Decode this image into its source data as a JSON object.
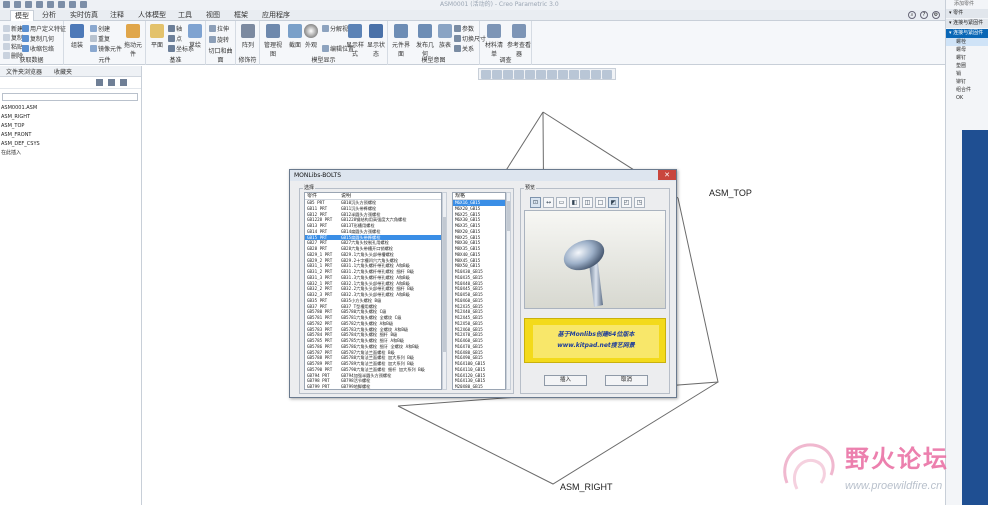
{
  "app": {
    "window_title": "ASM0001 (活动的) - Creo Parametric 3.0"
  },
  "tabs": [
    {
      "label": "模型",
      "active": true
    },
    {
      "label": "分析"
    },
    {
      "label": "实时仿真"
    },
    {
      "label": "注释"
    },
    {
      "label": "人体模型"
    },
    {
      "label": "工具"
    },
    {
      "label": "视图"
    },
    {
      "label": "框架"
    },
    {
      "label": "应用程序"
    }
  ],
  "ribbon": {
    "groups": {
      "data": "获取数据",
      "components": "元件",
      "datum": "基准",
      "cut": "切口和曲面",
      "modifiers": "修饰符",
      "model_display": "模型显示",
      "intent": "模型意图",
      "investigate": "调查"
    },
    "buttons": {
      "new": "新建",
      "copy": "复制",
      "paste": "粘贴",
      "delete": "删除",
      "user_feature": "用户定义特征",
      "copy_geometry": "复制几何",
      "shrinkwrap": "收缩包络",
      "assemble": "组装",
      "create": "创建",
      "repeat": "重复",
      "mirror": "镜像元件",
      "drag": "拖动元件",
      "plane": "平面",
      "axis": "轴",
      "point": "点",
      "csys": "坐标系",
      "sketch": "草绘",
      "extrude": "拉伸",
      "revolve": "旋转",
      "pattern": "阵列",
      "manage_views": "管理视图",
      "section": "截面",
      "appearance": "外观",
      "show_style": "显示样式",
      "display_states": "显示状态",
      "exploded": "分解视图",
      "edit_position": "编辑位置",
      "component_interface": "元件界面",
      "publish_geometry": "发布几何",
      "family_table": "族表",
      "parameters": "参数",
      "switch_dims": "切换尺寸",
      "relations": "关系",
      "bom": "材料清单",
      "ref_viewer": "参考查看器"
    }
  },
  "navigator": {
    "tabs": [
      "文件夹浏览器",
      "收藏夹"
    ],
    "tree": [
      "ASM0001.ASM",
      "ASM_RIGHT",
      "ASM_TOP",
      "ASM_FRONT",
      "ASM_DEF_CSYS",
      "在此插入"
    ]
  },
  "right_panel": {
    "header": "添加零件",
    "sections": [
      {
        "label": "零件",
        "items": []
      },
      {
        "label": "连接与紧固件",
        "items": []
      },
      {
        "label": "连接与紧固件",
        "items": [
          "螺栓",
          "螺母",
          "螺钉",
          "垫圈",
          "销",
          "铆钉",
          "组合件",
          "OK"
        ]
      }
    ]
  },
  "canvas": {
    "labels": {
      "top": "ASM_TOP",
      "right": "ASM_RIGHT"
    }
  },
  "dialog": {
    "title": "MONLibs-BOLTS",
    "close": "✕",
    "select_label": "选择",
    "preview_label": "预览",
    "std_headers": {
      "col1": "零件",
      "col2": "说明"
    },
    "spec_header": "规格",
    "standards": [
      {
        "file": "GB5 PRT",
        "desc": "GB10沉头方颈螺栓"
      },
      {
        "file": "GB11 PRT",
        "desc": "GB11沉头带榫螺栓"
      },
      {
        "file": "GB12 PRT",
        "desc": "GB12半圆头方颈螺栓"
      },
      {
        "file": "GB1228 PRT",
        "desc": "GB1228钢结构用高强度大六角螺栓"
      },
      {
        "file": "GB13 PRT",
        "desc": "GB13T形槽用螺栓"
      },
      {
        "file": "GB14 PRT",
        "desc": "GB14扁圆头方颈螺栓"
      },
      {
        "file": "GB15 PRT",
        "desc": "GB15扁圆头带榫螺栓",
        "selected": true
      },
      {
        "file": "GB27 PRT",
        "desc": "GB27六角头铰制孔用螺栓"
      },
      {
        "file": "GB28 PRT",
        "desc": "GB28六角头带槽开口销螺栓"
      },
      {
        "file": "GB29_1 PRT",
        "desc": "GB29.1六角头头部带槽螺栓"
      },
      {
        "file": "GB29_2 PRT",
        "desc": "GB29.2十字槽凹穴六角头螺栓"
      },
      {
        "file": "GB31_1 PRT",
        "desc": "GB31.1六角头螺杆带孔螺栓 A和B级"
      },
      {
        "file": "GB31_2 PRT",
        "desc": "GB31.2六角头螺杆带孔螺栓 细杆 B级"
      },
      {
        "file": "GB31_3 PRT",
        "desc": "GB31.3六角头螺杆带孔螺栓 A和B级"
      },
      {
        "file": "GB32_1 PRT",
        "desc": "GB32.1六角头头部带孔螺栓 A和B级"
      },
      {
        "file": "GB32_2 PRT",
        "desc": "GB32.2六角头头部带孔螺栓 细杆 B级"
      },
      {
        "file": "GB32_3 PRT",
        "desc": "GB32.3六角头头部带孔螺栓 A和B级"
      },
      {
        "file": "GB35 PRT",
        "desc": "GB35小方头螺栓 B级"
      },
      {
        "file": "GB37 PRT",
        "desc": "GB37 T型槽用螺栓"
      },
      {
        "file": "GB5780 PRT",
        "desc": "GB5780六角头螺栓 C级"
      },
      {
        "file": "GB5781 PRT",
        "desc": "GB5781六角头螺栓 全螺纹 C级"
      },
      {
        "file": "GB5782 PRT",
        "desc": "GB5782六角头螺栓 A和B级"
      },
      {
        "file": "GB5783 PRT",
        "desc": "GB5783六角头螺栓 全螺纹 A和B级"
      },
      {
        "file": "GB5784 PRT",
        "desc": "GB5784六角头螺栓 细杆 B级"
      },
      {
        "file": "GB5785 PRT",
        "desc": "GB5785六角头螺栓 细牙 A和B级"
      },
      {
        "file": "GB5786 PRT",
        "desc": "GB5786六角头螺栓 细牙 全螺纹 A和B级"
      },
      {
        "file": "GB5787 PRT",
        "desc": "GB5787六角法兰面螺栓 B级"
      },
      {
        "file": "GB5788 PRT",
        "desc": "GB5788六角法兰面螺栓 加大系列 B级"
      },
      {
        "file": "GB5789 PRT",
        "desc": "GB5789六角法兰面螺栓 加大系列 B级"
      },
      {
        "file": "GB5790 PRT",
        "desc": "GB5790六角法兰面螺栓 细杆 加大系列 B级"
      },
      {
        "file": "GB794 PRT",
        "desc": "GB794加强半圆头方颈螺栓"
      },
      {
        "file": "GB798 PRT",
        "desc": "GB798活节螺栓"
      },
      {
        "file": "GB799 PRT",
        "desc": "GB799地脚螺栓"
      },
      {
        "file": "GB8 PRT",
        "desc": "GB8方头螺栓"
      },
      {
        "file": "GB800 PRT",
        "desc": "GB800沉头双榫螺栓"
      }
    ],
    "specs": [
      {
        "label": "M6X16_GB15",
        "selected": true
      },
      "M6X20_GB15",
      "M6X25_GB15",
      "M6X30_GB15",
      "M6X35_GB15",
      "M8X20_GB15",
      "M8X25_GB15",
      "M8X30_GB15",
      "M8X35_GB15",
      "M8X40_GB15",
      "M8X45_GB15",
      "M8X50_GB15",
      "M10X30_GB15",
      "M10X35_GB15",
      "M10X40_GB15",
      "M10X45_GB15",
      "M10X50_GB15",
      "M10X60_GB15",
      "M12X35_GB15",
      "M12X40_GB15",
      "M12X45_GB15",
      "M12X50_GB15",
      "M12X60_GB15",
      "M12X70_GB15",
      "M16X60_GB15",
      "M16X70_GB15",
      "M16X80_GB15",
      "M16X90_GB15",
      "M16X100_GB15",
      "M16X110_GB15",
      "M16X120_GB15",
      "M16X130_GB15",
      "M20X80_GB15",
      "M20X90_GB15"
    ],
    "banner_line1": "基于Monlibs创建64位版本",
    "banner_line2": "www.kitpad.net搜艺网景",
    "insert_button": "插入",
    "cancel_button": "取消"
  },
  "watermark": {
    "text": "野火论坛",
    "url": "www.proewildfire.cn"
  },
  "colors": {
    "accent": "#0a67b6",
    "selection": "#3a8ee6",
    "banner": "#f3da1b",
    "banner_text": "#1d3c9b",
    "watermark": "#e96aa0"
  }
}
